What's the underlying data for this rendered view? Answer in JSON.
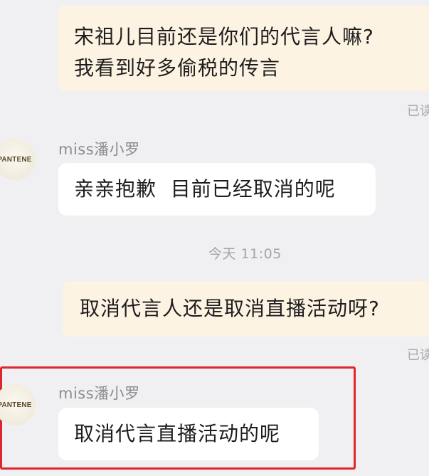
{
  "messages": {
    "out1": {
      "line1": "宋祖儿目前还是你们的代言人嘛?",
      "line2": "我看到好多偷税的传言",
      "status": "已读"
    },
    "in1": {
      "sender": "miss潘小罗",
      "avatar_brand": "PANTENE",
      "text": "亲亲抱歉  目前已经取消的呢"
    },
    "timestamp": "今天 11:05",
    "out2": {
      "text": "取消代言人还是取消直播活动呀?",
      "status": "已读"
    },
    "in2": {
      "sender": "miss潘小罗",
      "avatar_brand": "PANTENE",
      "text": "取消代言直播活动的呢"
    }
  },
  "colors": {
    "background": "#f0f0f2",
    "outgoing_bubble": "#fdf3e3",
    "incoming_bubble": "#ffffff",
    "highlight_border": "#e0262b"
  }
}
